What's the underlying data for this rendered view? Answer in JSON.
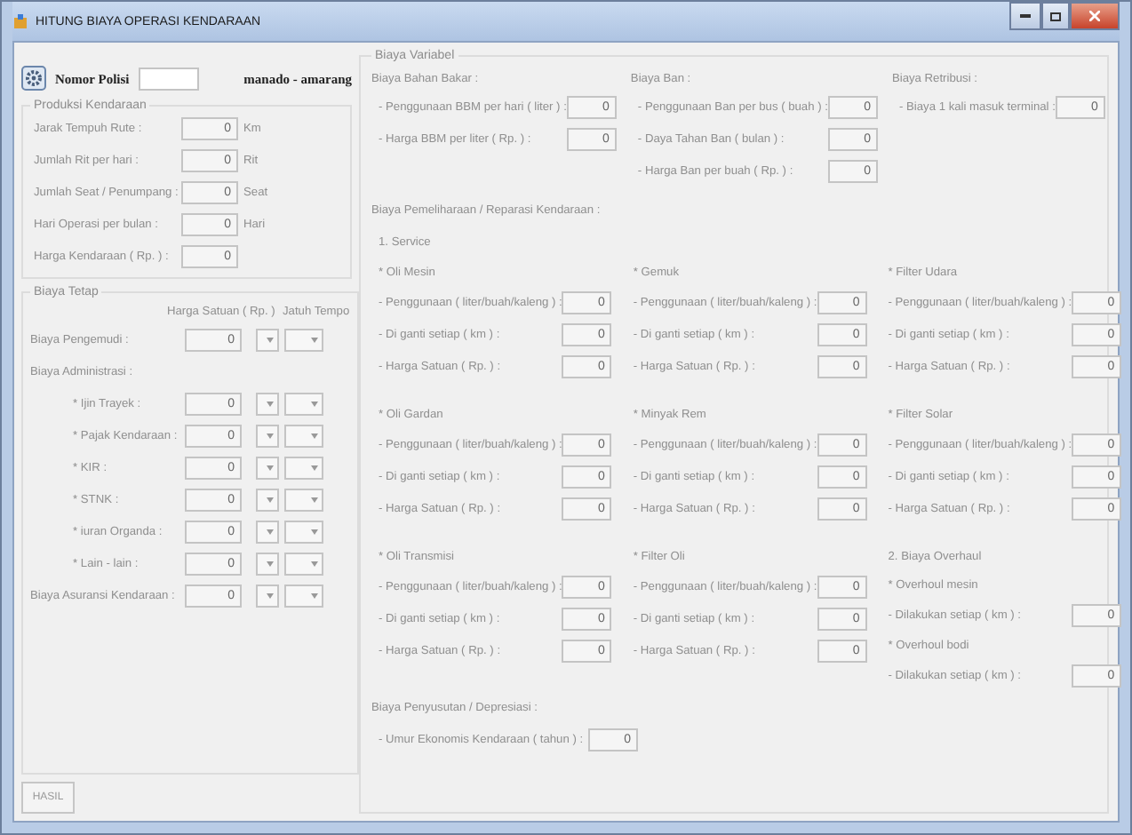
{
  "window": {
    "title": "HITUNG BIAYA OPERASI KENDARAAN"
  },
  "header": {
    "plate_label": "Nomor Polisi",
    "route": "manado - amarang"
  },
  "produksi": {
    "title": "Produksi Kendaraan",
    "rows": [
      {
        "label": "Jarak Tempuh Rute :",
        "value": "0",
        "unit": "Km"
      },
      {
        "label": "Jumlah Rit per hari :",
        "value": "0",
        "unit": "Rit"
      },
      {
        "label": "Jumlah Seat / Penumpang :",
        "value": "0",
        "unit": "Seat"
      },
      {
        "label": "Hari Operasi per bulan :",
        "value": "0",
        "unit": "Hari"
      },
      {
        "label": "Harga Kendaraan ( Rp. ) :",
        "value": "0"
      }
    ]
  },
  "biaya_tetap": {
    "title": "Biaya Tetap",
    "col_headers": [
      "Harga Satuan ( Rp. )",
      "Jatuh Tempo"
    ],
    "rows": [
      {
        "kind": "item",
        "label": "Biaya Pengemudi :",
        "value": "0"
      },
      {
        "kind": "heading",
        "label": "Biaya Administrasi :"
      },
      {
        "kind": "subitem",
        "label": "* Ijin Trayek :",
        "value": "0"
      },
      {
        "kind": "subitem",
        "label": "* Pajak Kendaraan :",
        "value": "0"
      },
      {
        "kind": "subitem",
        "label": "* KIR :",
        "value": "0"
      },
      {
        "kind": "subitem",
        "label": "* STNK :",
        "value": "0"
      },
      {
        "kind": "subitem",
        "label": "* iuran Organda :",
        "value": "0"
      },
      {
        "kind": "subitem",
        "label": "* Lain - lain :",
        "value": "0"
      },
      {
        "kind": "item",
        "label": "Biaya Asuransi Kendaraan :",
        "value": "0"
      }
    ]
  },
  "hasil_button": "HASIL",
  "biaya_variabel": {
    "title": "Biaya Variabel",
    "top_groups": [
      {
        "title": "Biaya Bahan Bakar :",
        "rows": [
          {
            "label": "- Penggunaan BBM per hari ( liter ) :",
            "value": "0"
          },
          {
            "label": "- Harga BBM per liter ( Rp. ) :",
            "value": "0"
          }
        ]
      },
      {
        "title": "Biaya Ban :",
        "rows": [
          {
            "label": "- Penggunaan Ban per bus ( buah ) :",
            "value": "0"
          },
          {
            "label": "- Daya Tahan Ban ( bulan ) :",
            "value": "0"
          },
          {
            "label": "- Harga Ban per buah ( Rp. ) :",
            "value": "0"
          }
        ]
      },
      {
        "title": "Biaya Retribusi :",
        "rows": [
          {
            "label": "- Biaya 1 kali masuk terminal :",
            "value": "0"
          }
        ]
      }
    ],
    "maintenance_title": "Biaya Pemeliharaan / Reparasi Kendaraan :",
    "service_title": "1. Service",
    "service_groups": [
      {
        "title": "* Oli Mesin",
        "rows": [
          {
            "label": "- Penggunaan ( liter/buah/kaleng ) :",
            "value": "0"
          },
          {
            "label": "- Di ganti setiap ( km ) :",
            "value": "0"
          },
          {
            "label": "- Harga Satuan ( Rp. ) :",
            "value": "0"
          }
        ]
      },
      {
        "title": "* Gemuk",
        "rows": [
          {
            "label": "- Penggunaan ( liter/buah/kaleng ) :",
            "value": "0"
          },
          {
            "label": "- Di ganti setiap ( km ) :",
            "value": "0"
          },
          {
            "label": "- Harga Satuan ( Rp. ) :",
            "value": "0"
          }
        ]
      },
      {
        "title": "* Filter Udara",
        "rows": [
          {
            "label": "- Penggunaan ( liter/buah/kaleng ) :",
            "value": "0"
          },
          {
            "label": "- Di ganti setiap ( km ) :",
            "value": "0"
          },
          {
            "label": "- Harga Satuan ( Rp. ) :",
            "value": "0"
          }
        ]
      },
      {
        "title": "* Oli Gardan",
        "rows": [
          {
            "label": "- Penggunaan ( liter/buah/kaleng ) :",
            "value": "0"
          },
          {
            "label": "- Di ganti setiap ( km ) :",
            "value": "0"
          },
          {
            "label": "- Harga Satuan ( Rp. ) :",
            "value": "0"
          }
        ]
      },
      {
        "title": "* Minyak Rem",
        "rows": [
          {
            "label": "- Penggunaan ( liter/buah/kaleng ) :",
            "value": "0"
          },
          {
            "label": "- Di ganti setiap ( km ) :",
            "value": "0"
          },
          {
            "label": "- Harga Satuan ( Rp. ) :",
            "value": "0"
          }
        ]
      },
      {
        "title": "* Filter Solar",
        "rows": [
          {
            "label": "- Penggunaan ( liter/buah/kaleng ) :",
            "value": "0"
          },
          {
            "label": "- Di ganti setiap ( km ) :",
            "value": "0"
          },
          {
            "label": "- Harga Satuan ( Rp. ) :",
            "value": "0"
          }
        ]
      },
      {
        "title": "* Oli Transmisi",
        "rows": [
          {
            "label": "- Penggunaan ( liter/buah/kaleng ) :",
            "value": "0"
          },
          {
            "label": "- Di ganti setiap ( km ) :",
            "value": "0"
          },
          {
            "label": "- Harga Satuan ( Rp. ) :",
            "value": "0"
          }
        ]
      },
      {
        "title": "* Filter Oli",
        "rows": [
          {
            "label": "- Penggunaan ( liter/buah/kaleng ) :",
            "value": "0"
          },
          {
            "label": "- Di ganti setiap ( km ) :",
            "value": "0"
          },
          {
            "label": "- Harga Satuan ( Rp. ) :",
            "value": "0"
          }
        ]
      }
    ],
    "overhaul": {
      "title": "2. Biaya Overhaul",
      "items": [
        {
          "title": "* Overhoul mesin",
          "label": "- Dilakukan setiap ( km ) :",
          "value": "0"
        },
        {
          "title": "* Overhoul bodi",
          "label": "- Dilakukan setiap ( km ) :",
          "value": "0"
        }
      ]
    },
    "depresiasi": {
      "title": "Biaya Penyusutan / Depresiasi :",
      "label": "- Umur Ekonomis Kendaraan ( tahun ) :",
      "value": "0"
    }
  }
}
